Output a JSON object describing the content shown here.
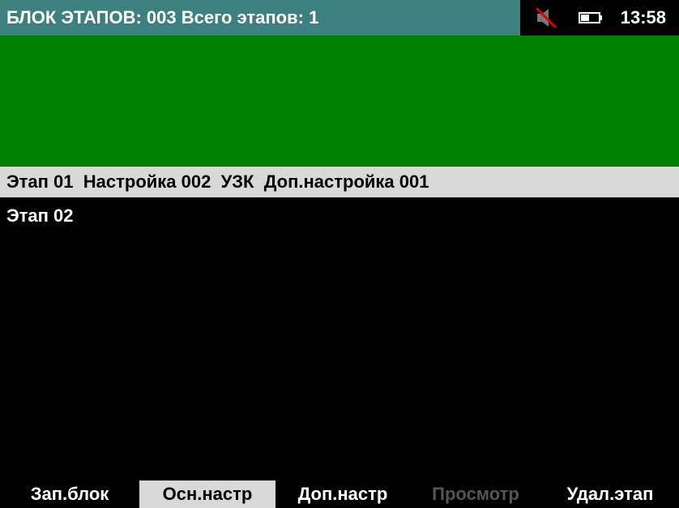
{
  "header": {
    "title": "БЛОК ЭТАПОВ: 003 Всего этапов: 1",
    "time": "13:58",
    "icons": {
      "mute": "mute-speaker-icon",
      "battery": "battery-icon"
    },
    "title_bg": "#3d8080"
  },
  "panel": {
    "color": "#008000"
  },
  "stages": [
    {
      "label": "Этап 01  Настройка 002  УЗК  Доп.настройка 001",
      "selected": true
    },
    {
      "label": "Этап 02",
      "selected": false
    }
  ],
  "softkeys": [
    {
      "label": "Зап.блок",
      "state": "normal"
    },
    {
      "label": "Осн.настр",
      "state": "active"
    },
    {
      "label": "Доп.настр",
      "state": "normal"
    },
    {
      "label": "Просмотр",
      "state": "disabled"
    },
    {
      "label": "Удал.этап",
      "state": "normal"
    }
  ]
}
